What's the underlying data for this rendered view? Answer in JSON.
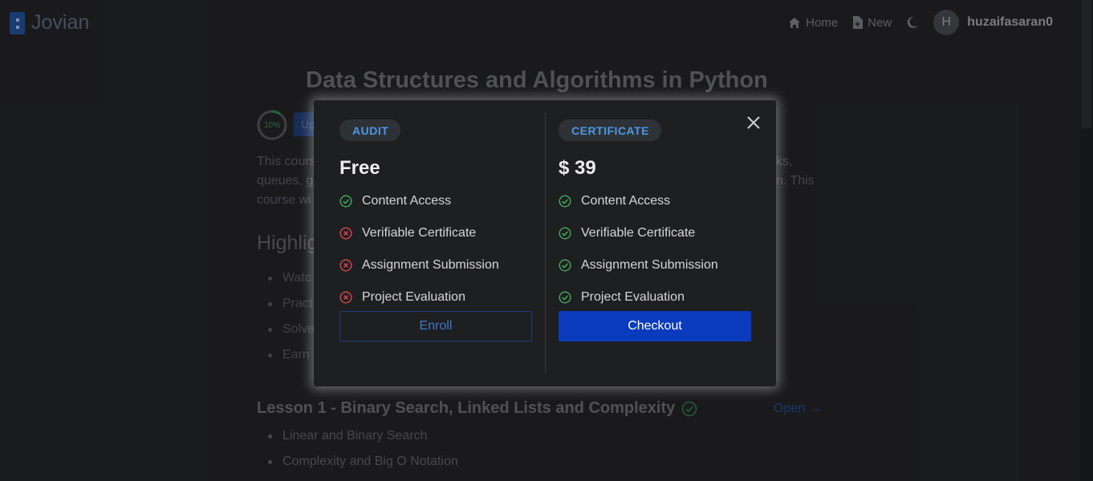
{
  "app": {
    "logo_text": "Jovian"
  },
  "nav": {
    "home_label": "Home",
    "new_label": "New",
    "avatar_initial": "H",
    "username": "huzaifasaran0"
  },
  "course": {
    "title": "Data Structures and Algorithms in Python",
    "progress_label": "10%",
    "progress_percent": 10,
    "upgrade_label": "Up",
    "description_lines": [
      "This cours",
      "queues, g",
      "course wi"
    ],
    "description_tail_1": "ks,",
    "description_tail_2": "n. This",
    "highlights_heading": "Highlig",
    "highlights": [
      "Watc",
      "Pract",
      "Solve",
      "Earn"
    ]
  },
  "lesson": {
    "title": "Lesson 1 - Binary Search, Linked Lists and Complexity",
    "open_label": "Open →",
    "topics": [
      "Linear and Binary Search",
      "Complexity and Big O Notation"
    ]
  },
  "modal": {
    "audit": {
      "badge": "AUDIT",
      "price": "Free",
      "features": [
        {
          "label": "Content Access",
          "included": true
        },
        {
          "label": "Verifiable Certificate",
          "included": false
        },
        {
          "label": "Assignment Submission",
          "included": false
        },
        {
          "label": "Project Evaluation",
          "included": false
        }
      ],
      "button_label": "Enroll"
    },
    "certificate": {
      "badge": "CERTIFICATE",
      "price": "$ 39",
      "features": [
        {
          "label": "Content Access",
          "included": true
        },
        {
          "label": "Verifiable Certificate",
          "included": true
        },
        {
          "label": "Assignment Submission",
          "included": true
        },
        {
          "label": "Project Evaluation",
          "included": true
        }
      ],
      "button_label": "Checkout"
    }
  },
  "colors": {
    "accent": "#0a3bbd",
    "badge_text": "#4d97e6",
    "check_green": "#3fae5c",
    "cross_red": "#e0454f"
  },
  "icons": {
    "included": "check-circle-icon",
    "excluded": "x-circle-icon",
    "close": "close-icon"
  }
}
